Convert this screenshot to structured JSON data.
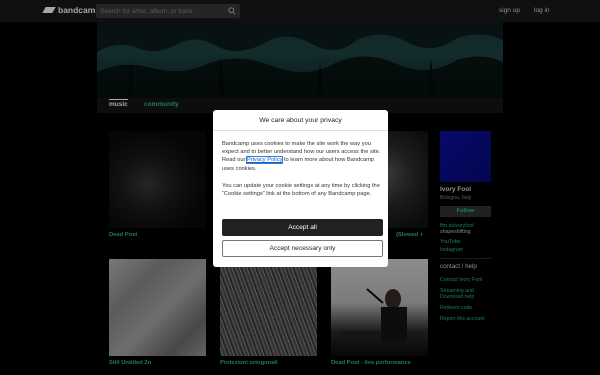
{
  "header": {
    "logo_text": "bandcamp",
    "search_placeholder": "Search for artist, album, or track",
    "signup_label": "sign up",
    "login_label": "log in"
  },
  "tabs": [
    {
      "label": "music",
      "active": true
    },
    {
      "label": "community",
      "active": false
    }
  ],
  "releases": [
    {
      "title": "Dead Poet"
    },
    {
      "title": "(Slowed +"
    },
    {
      "title": "Still Untitled 2n"
    },
    {
      "title": "Proiezioni ortogonali"
    },
    {
      "title": "Dead Poet - live performance"
    }
  ],
  "sidebar": {
    "artist_name": "Ivory Fool",
    "location": "Bologna, Italy",
    "follow_label": "Follow",
    "site_link": "ffm.to/ivoryfool",
    "site_sub": "shapeshifting",
    "links": [
      "YouTube",
      "Instagram"
    ],
    "contact_heading": "contact / help",
    "help_links": [
      "Contact Ivory Fool",
      "Streaming and",
      "Download help",
      "Redeem code",
      "Report this account"
    ]
  },
  "modal": {
    "title": "We care about your privacy",
    "para1_before": "Bandcamp uses cookies to make the site work the way you expect and to better understand how our users access the site. Read our ",
    "privacy_link": "Privacy Policy",
    "para1_after": " to learn more about how Bandcamp uses cookies.",
    "para2": "You can update your cookie settings at any time by clicking the “Cookie settings” link at the bottom of any Bandcamp page.",
    "accept_all": "Accept all",
    "accept_necessary": "Accept necessary only"
  },
  "colors": {
    "accent": "#2dbf9a",
    "topbar": "#1a1a1a",
    "sidebar_art": "#0b0fa8"
  }
}
